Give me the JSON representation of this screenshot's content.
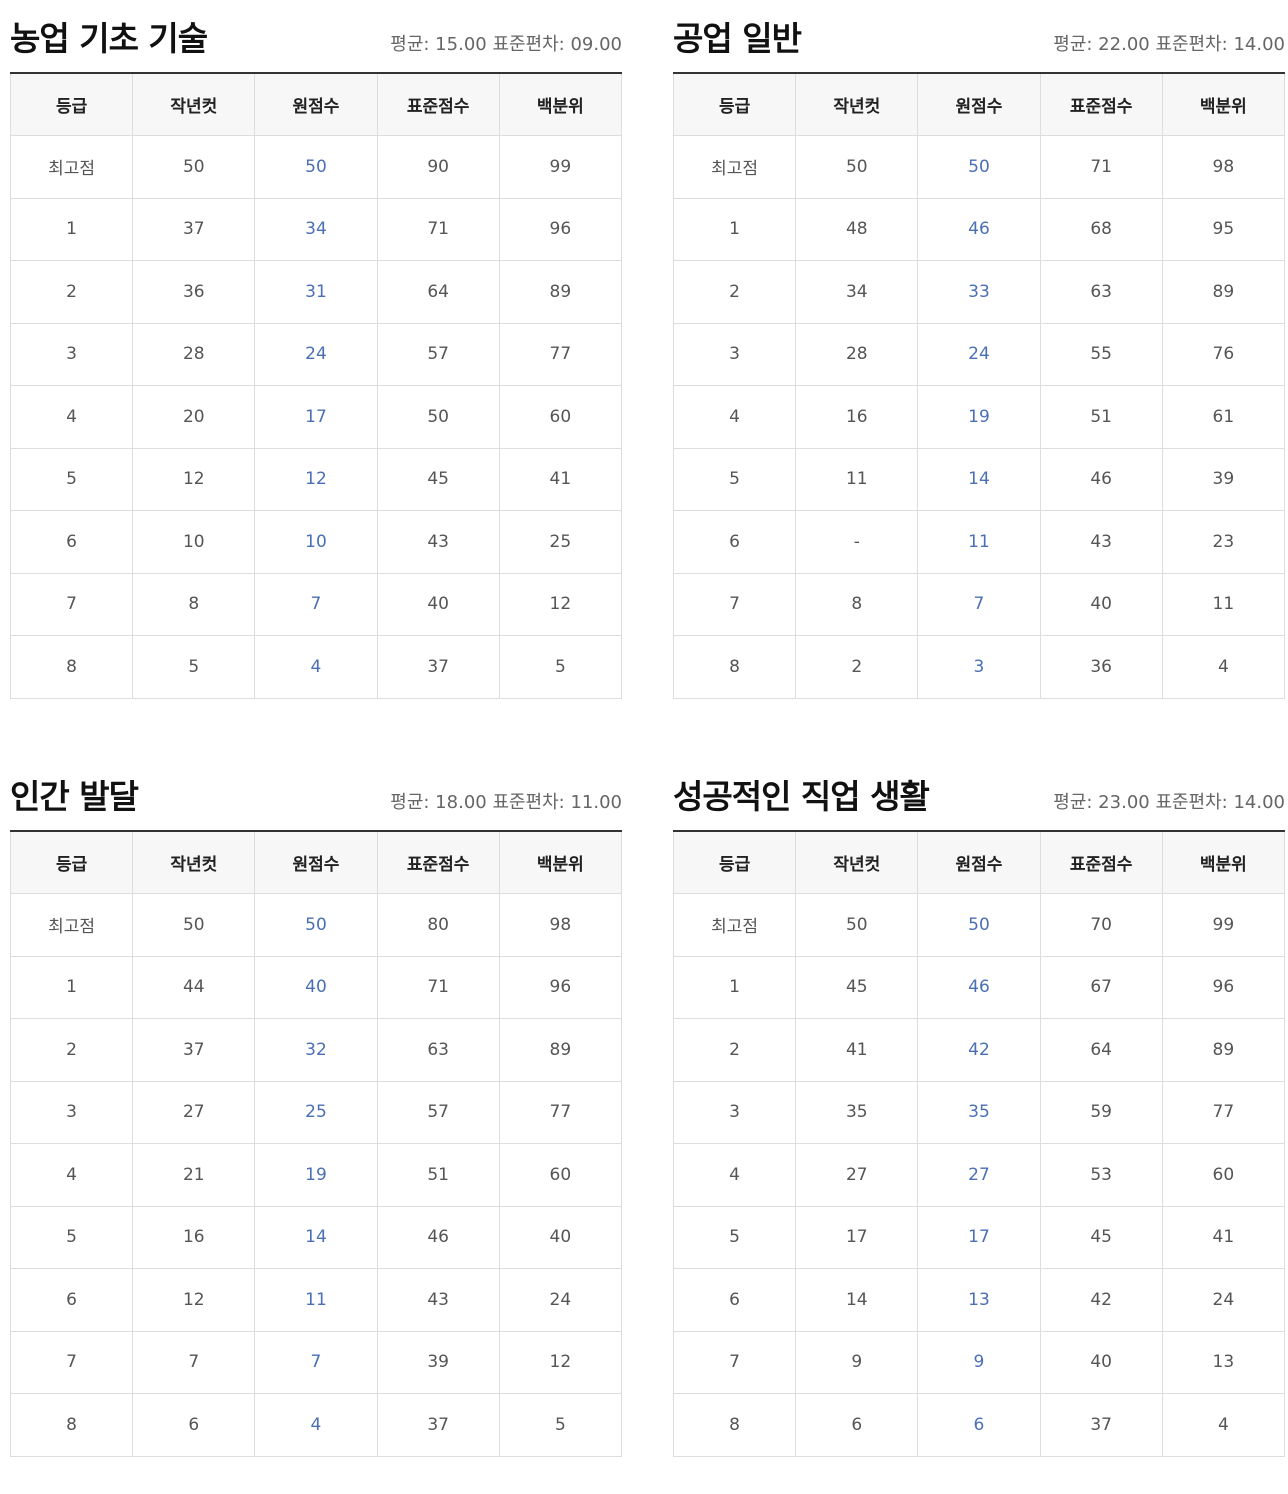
{
  "headers": [
    "등급",
    "작년컷",
    "원점수",
    "표준점수",
    "백분위"
  ],
  "tables": [
    {
      "title": "농업 기초 기술",
      "stats": "평균: 15.00 표준편차: 09.00",
      "rows": [
        [
          "최고점",
          "50",
          "50",
          "90",
          "99"
        ],
        [
          "1",
          "37",
          "34",
          "71",
          "96"
        ],
        [
          "2",
          "36",
          "31",
          "64",
          "89"
        ],
        [
          "3",
          "28",
          "24",
          "57",
          "77"
        ],
        [
          "4",
          "20",
          "17",
          "50",
          "60"
        ],
        [
          "5",
          "12",
          "12",
          "45",
          "41"
        ],
        [
          "6",
          "10",
          "10",
          "43",
          "25"
        ],
        [
          "7",
          "8",
          "7",
          "40",
          "12"
        ],
        [
          "8",
          "5",
          "4",
          "37",
          "5"
        ]
      ]
    },
    {
      "title": "공업 일반",
      "stats": "평균: 22.00 표준편차: 14.00",
      "rows": [
        [
          "최고점",
          "50",
          "50",
          "71",
          "98"
        ],
        [
          "1",
          "48",
          "46",
          "68",
          "95"
        ],
        [
          "2",
          "34",
          "33",
          "63",
          "89"
        ],
        [
          "3",
          "28",
          "24",
          "55",
          "76"
        ],
        [
          "4",
          "16",
          "19",
          "51",
          "61"
        ],
        [
          "5",
          "11",
          "14",
          "46",
          "39"
        ],
        [
          "6",
          "-",
          "11",
          "43",
          "23"
        ],
        [
          "7",
          "8",
          "7",
          "40",
          "11"
        ],
        [
          "8",
          "2",
          "3",
          "36",
          "4"
        ]
      ]
    },
    {
      "title": "인간 발달",
      "stats": "평균: 18.00 표준편차: 11.00",
      "rows": [
        [
          "최고점",
          "50",
          "50",
          "80",
          "98"
        ],
        [
          "1",
          "44",
          "40",
          "71",
          "96"
        ],
        [
          "2",
          "37",
          "32",
          "63",
          "89"
        ],
        [
          "3",
          "27",
          "25",
          "57",
          "77"
        ],
        [
          "4",
          "21",
          "19",
          "51",
          "60"
        ],
        [
          "5",
          "16",
          "14",
          "46",
          "40"
        ],
        [
          "6",
          "12",
          "11",
          "43",
          "24"
        ],
        [
          "7",
          "7",
          "7",
          "39",
          "12"
        ],
        [
          "8",
          "6",
          "4",
          "37",
          "5"
        ]
      ]
    },
    {
      "title": "성공적인 직업 생활",
      "stats": "평균: 23.00 표준편차: 14.00",
      "rows": [
        [
          "최고점",
          "50",
          "50",
          "70",
          "99"
        ],
        [
          "1",
          "45",
          "46",
          "67",
          "96"
        ],
        [
          "2",
          "41",
          "42",
          "64",
          "89"
        ],
        [
          "3",
          "35",
          "35",
          "59",
          "77"
        ],
        [
          "4",
          "27",
          "27",
          "53",
          "60"
        ],
        [
          "5",
          "17",
          "17",
          "45",
          "41"
        ],
        [
          "6",
          "14",
          "13",
          "42",
          "24"
        ],
        [
          "7",
          "9",
          "9",
          "40",
          "13"
        ],
        [
          "8",
          "6",
          "6",
          "37",
          "4"
        ]
      ]
    }
  ],
  "colors": {
    "raw_score": "#4a6fb5",
    "header_bg": "#f7f7f7",
    "border": "#dddddd",
    "rule": "#333333"
  }
}
